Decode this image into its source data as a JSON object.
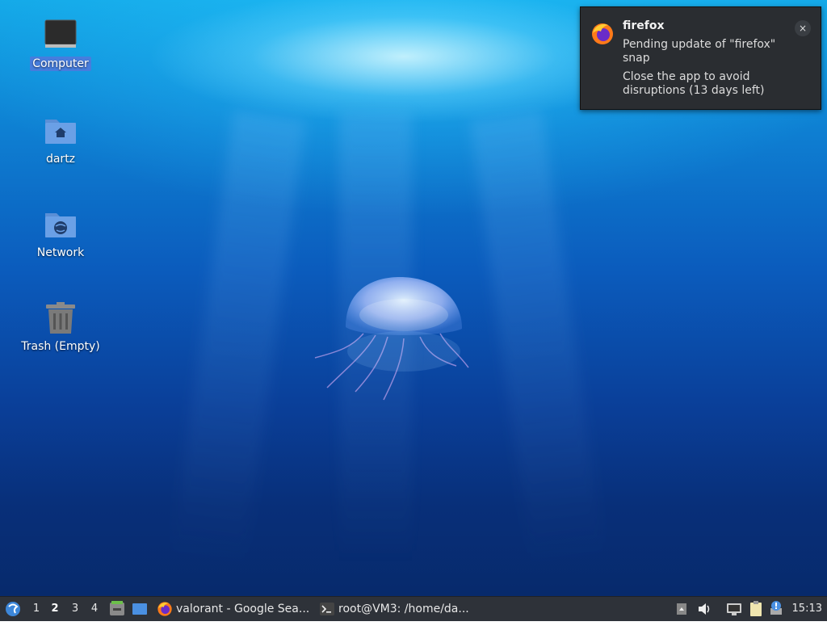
{
  "desktop": {
    "icons": [
      {
        "label": "Computer",
        "icon": "computer-icon",
        "selected": true
      },
      {
        "label": "dartz",
        "icon": "home-folder-icon"
      },
      {
        "label": "Network",
        "icon": "network-folder-icon"
      },
      {
        "label": "Trash (Empty)",
        "icon": "trash-icon"
      }
    ]
  },
  "notification": {
    "app": "firefox",
    "line1": "Pending update of \"firefox\" snap",
    "line2": "Close the app to avoid disruptions (13 days left)",
    "close": "×",
    "icon": "firefox-icon"
  },
  "panel": {
    "workspaces": [
      "1",
      "2",
      "3",
      "4"
    ],
    "active_workspace": "2",
    "tasks": [
      {
        "label": "valorant - Google Sea...",
        "icon": "firefox-icon"
      },
      {
        "label": "root@VM3: /home/da...",
        "icon": "terminal-icon"
      }
    ],
    "clock": "15:13",
    "colors": {
      "panel": "#2e3239",
      "notification": "#2a2d31"
    }
  }
}
